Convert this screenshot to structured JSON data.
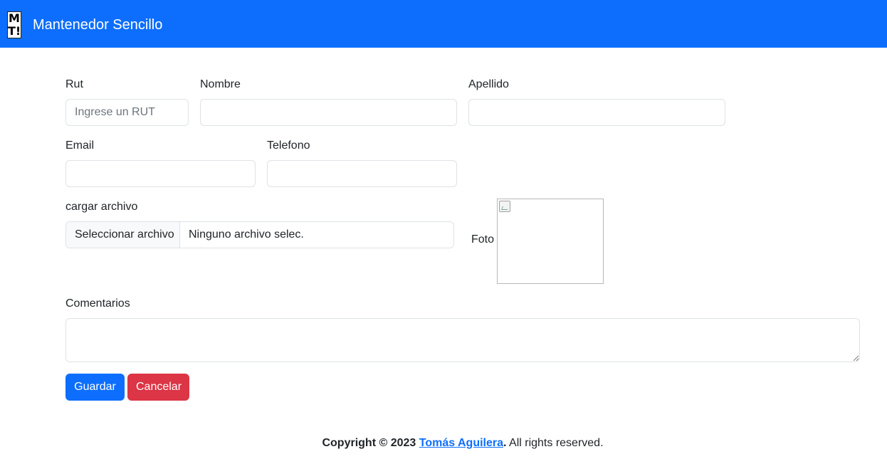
{
  "navbar": {
    "logo_line1": "M",
    "logo_line2": "T!",
    "brand": "Mantenedor Sencillo",
    "color": "#0d6efd"
  },
  "form": {
    "rut": {
      "label": "Rut",
      "placeholder": "Ingrese un RUT",
      "value": ""
    },
    "nombre": {
      "label": "Nombre",
      "value": ""
    },
    "apellido": {
      "label": "Apellido",
      "value": ""
    },
    "email": {
      "label": "Email",
      "value": ""
    },
    "telefono": {
      "label": "Telefono",
      "value": ""
    },
    "archivo": {
      "label": "cargar archivo",
      "button": "Seleccionar archivo",
      "status": "Ninguno archivo selec."
    },
    "foto": {
      "label": "Foto"
    },
    "comentarios": {
      "label": "Comentarios",
      "value": ""
    },
    "buttons": {
      "save": "Guardar",
      "cancel": "Cancelar"
    }
  },
  "colors": {
    "primary": "#0d6efd",
    "danger": "#dc3545"
  },
  "footer": {
    "copyright": "Copyright © 2023",
    "author": "Tomás Aguilera",
    "period": ".",
    "rights": " All rights reserved."
  }
}
